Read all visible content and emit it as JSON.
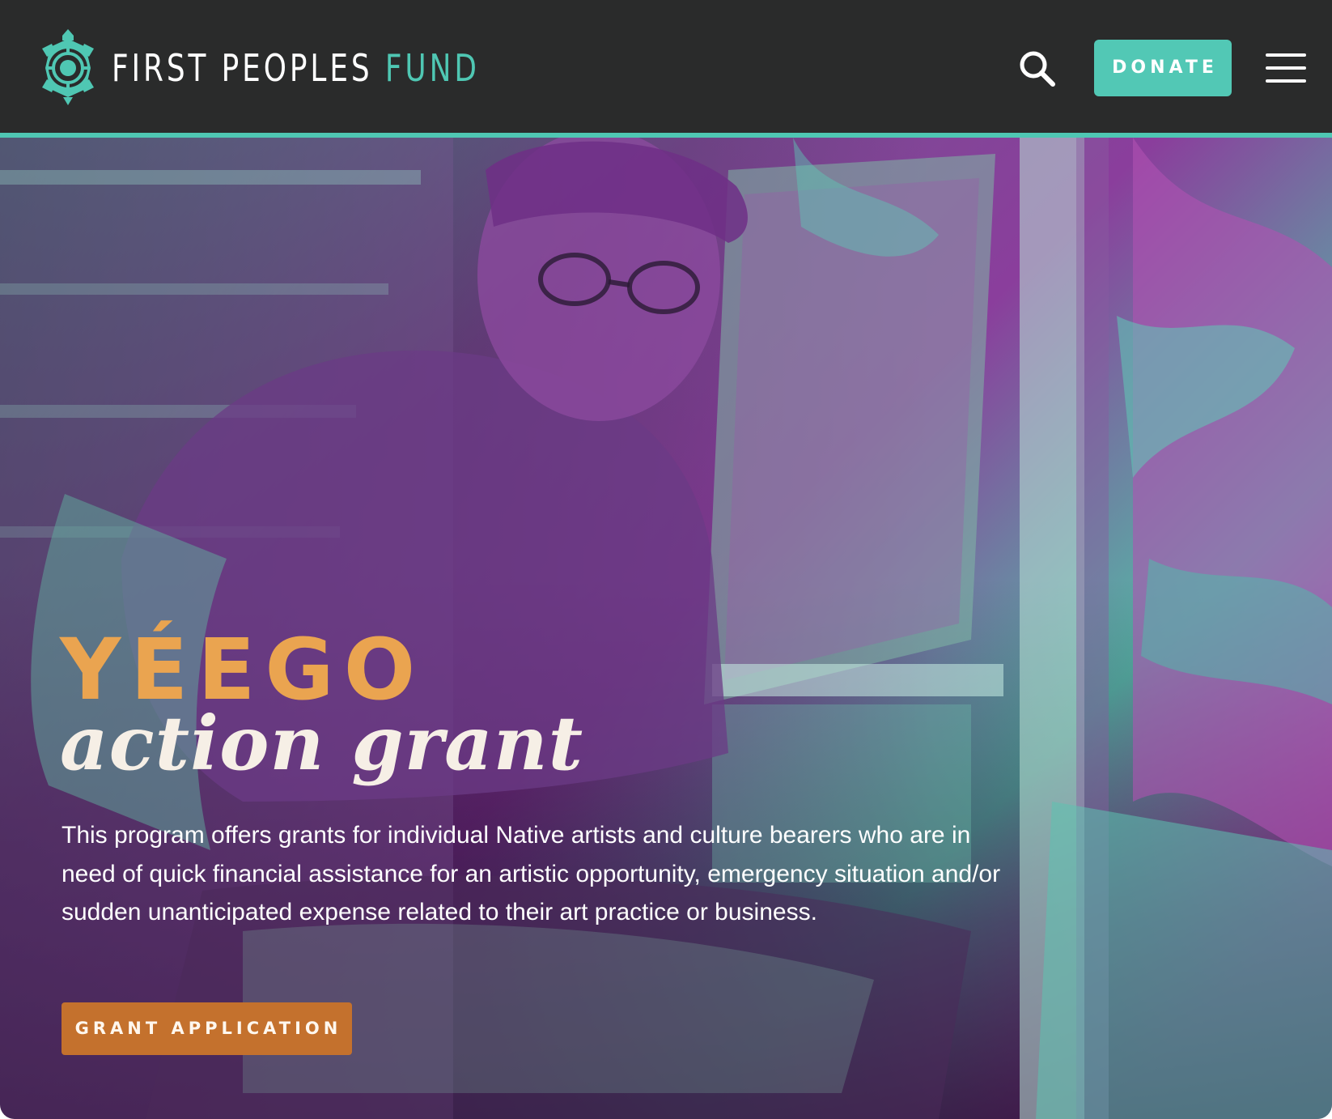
{
  "header": {
    "logo": {
      "text_primary": "FIRST PEOPLES",
      "text_accent": "FUND",
      "icon": "turtle-logo-icon"
    },
    "search_icon": "search-icon",
    "donate_label": "DONATE",
    "menu_icon": "hamburger-menu-icon"
  },
  "hero": {
    "title": "YÉEGO",
    "subtitle": "action grant",
    "description": "This program offers grants for individual Native artists and culture bearers who are in need of quick financial assistance for an artistic opportunity, emergency situation and/or sudden unanticipated expense related to their art practice or business.",
    "cta_label": "GRANT APPLICATION"
  },
  "colors": {
    "header_bg": "#2a2b2b",
    "accent_teal": "#4fc7b3",
    "title_orange": "#eaa450",
    "cta_orange": "#c4712d",
    "hero_magenta": "#8a3e9c"
  }
}
